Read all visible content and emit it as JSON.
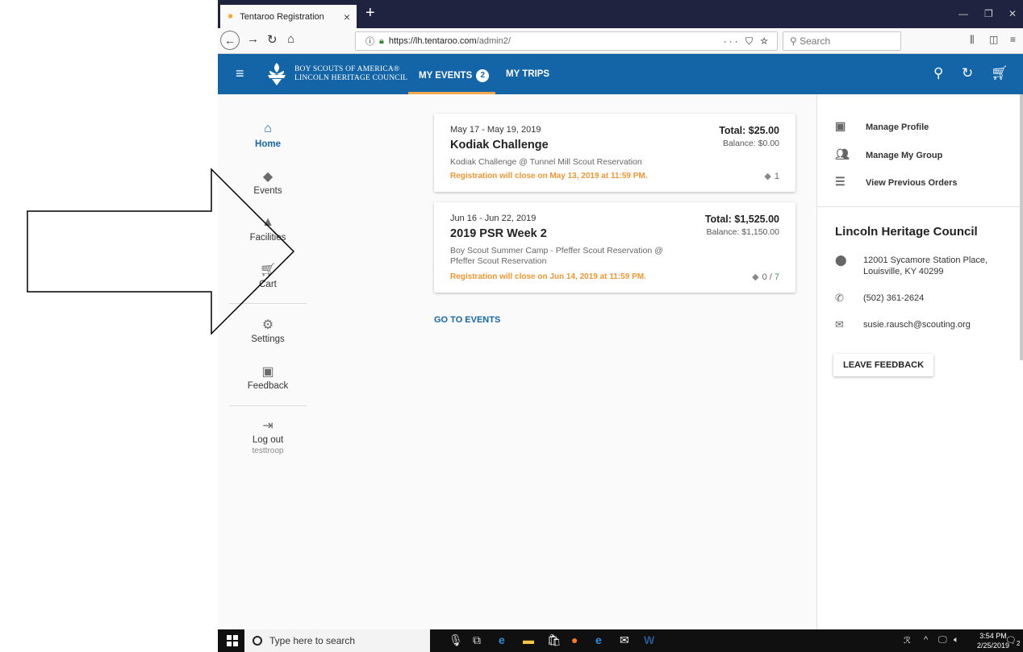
{
  "browser": {
    "tab_title": "Tentaroo Registration",
    "tab_close": "×",
    "new_tab": "+",
    "url_host": "https://lh.tentaroo.com",
    "url_path": "/admin2/",
    "url_actions": "··· ⛉ ☆",
    "search_placeholder": "Search"
  },
  "header": {
    "org_line1": "BOY SCOUTS OF AMERICA®",
    "org_line2": "LINCOLN HERITAGE COUNCIL",
    "nav_my_events": "MY EVENTS",
    "nav_my_events_count": "2",
    "nav_my_trips": "MY TRIPS",
    "accent": "#1365a8"
  },
  "sidebar": {
    "items": [
      {
        "label": "Home",
        "icon": "home-icon"
      },
      {
        "label": "Events",
        "icon": "tickets-icon"
      },
      {
        "label": "Facilities",
        "icon": "tent-icon"
      },
      {
        "label": "Cart",
        "icon": "cart-icon"
      },
      {
        "label": "Settings",
        "icon": "gear-icon"
      },
      {
        "label": "Feedback",
        "icon": "feedback-icon"
      },
      {
        "label": "Log out",
        "icon": "logout-icon",
        "sub": "testtroop"
      }
    ]
  },
  "events": [
    {
      "date": "May 17 - May 19, 2019",
      "name": "Kodiak Challenge",
      "desc": "Kodiak Challenge @ Tunnel Mill Scout Reservation",
      "close_text": "Registration will close on May 13, 2019 at 11:59 PM.",
      "total": "Total: $25.00",
      "balance": "Balance: $0.00",
      "count": "1"
    },
    {
      "date": "Jun 16 - Jun 22, 2019",
      "name": "2019 PSR Week 2",
      "desc": "Boy Scout Summer Camp - Pfeffer Scout Reservation @ Pfeffer Scout Reservation",
      "close_text": "Registration will close on Jun 14, 2019 at 11:59 PM.",
      "total": "Total: $1,525.00",
      "balance": "Balance: $1,150.00",
      "count_a": "0",
      "count_sep": "/",
      "count_b": "7"
    }
  ],
  "go_to_events": "GO TO EVENTS",
  "right_panel": {
    "manage_profile": "Manage Profile",
    "manage_group": "Manage My Group",
    "previous_orders": "View Previous Orders",
    "council": "Lincoln Heritage Council",
    "address_line1": "12001 Sycamore Station Place,",
    "address_line2": "Louisville, KY 40299",
    "phone": "(502) 361-2624",
    "email": "susie.rausch@scouting.org",
    "feedback_button": "LEAVE FEEDBACK"
  },
  "taskbar": {
    "search_placeholder": "Type here to search",
    "time": "3:54 PM",
    "date": "2/25/2019",
    "notif_count": "2"
  }
}
